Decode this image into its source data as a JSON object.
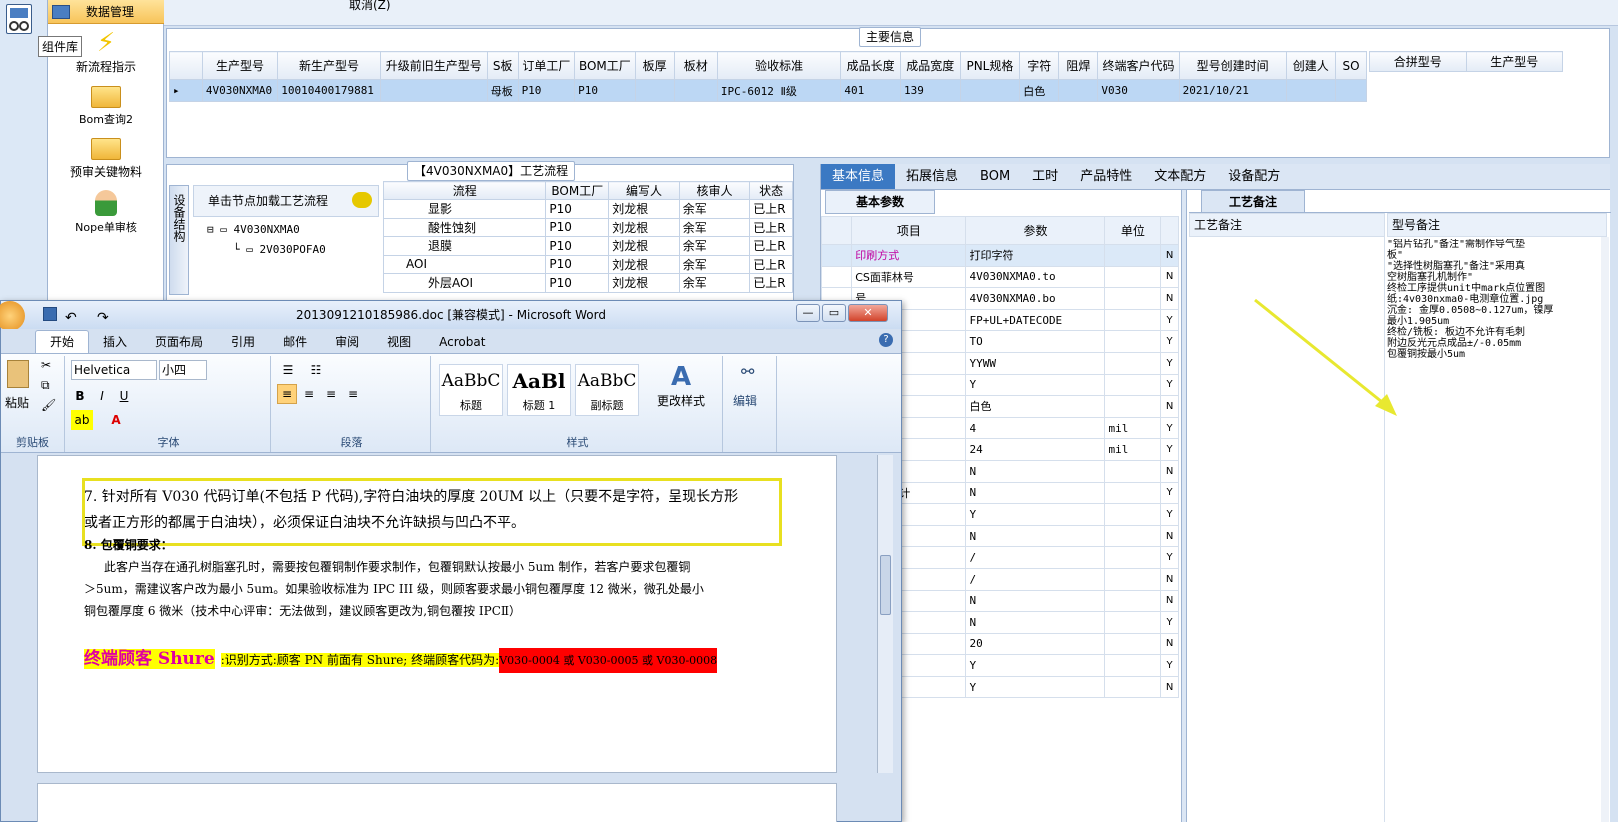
{
  "launcher": {
    "title": "数据管理",
    "tooltip": "组件库",
    "items": [
      "新流程指示",
      "Bom查询2",
      "预审关键物料",
      "Nope单审核"
    ]
  },
  "topstrip": {
    "cancel": "取消(Z)"
  },
  "main_info": {
    "title": "主要信息",
    "columns": [
      "生产型号",
      "新生产型号",
      "升级前旧生产型号",
      "S板",
      "订单工厂",
      "BOM工厂",
      "板厚",
      "板材",
      "验收标准",
      "成品长度",
      "成品宽度",
      "PNL规格",
      "字符",
      "阻焊",
      "终端客户代码",
      "型号创建时间",
      "创建人",
      "SO"
    ],
    "row": [
      "4V030NXMA0",
      "10010400179881",
      "",
      "母板",
      "P10",
      "P10",
      "",
      "",
      "IPC-6012 Ⅱ级",
      "401",
      "139",
      "",
      "白色",
      "",
      "V030",
      "2021/10/21",
      "",
      ""
    ],
    "side_columns": [
      "合拼型号",
      "生产型号"
    ]
  },
  "process": {
    "title": "【4V030NXMA0】工艺流程",
    "side_label": "设备结构",
    "hint": "单击节点加载工艺流程",
    "tree": [
      "4V030NXMA0",
      "2V030POFA0"
    ],
    "columns": [
      "流程",
      "BOM工厂",
      "编写人",
      "核审人",
      "状态"
    ],
    "rows": [
      [
        "显影",
        "P10",
        "刘龙根",
        "余军",
        "已上R"
      ],
      [
        "酸性蚀刻",
        "P10",
        "刘龙根",
        "余军",
        "已上R"
      ],
      [
        "退膜",
        "P10",
        "刘龙根",
        "余军",
        "已上R"
      ],
      [
        "AOI",
        "P10",
        "刘龙根",
        "余军",
        "已上R"
      ],
      [
        "外层AOI",
        "P10",
        "刘龙根",
        "余军",
        "已上R"
      ]
    ]
  },
  "right": {
    "tabs": [
      "基本信息",
      "拓展信息",
      "BOM",
      "工时",
      "产品特性",
      "文本配方",
      "设备配方"
    ],
    "subtab": "基本参数",
    "columns": [
      "项目",
      "参数",
      "单位"
    ],
    "rows": [
      [
        "印刷方式",
        "打印字符",
        "",
        "N"
      ],
      [
        "CS面菲林号",
        "4V030NXMA0.to",
        "",
        "N"
      ],
      [
        "号",
        "4V030NXMA0.bo",
        "",
        "N"
      ],
      [
        "",
        "FP+UL+DATECODE",
        "",
        "Y"
      ],
      [
        "位置",
        "TO",
        "",
        "Y"
      ],
      [
        "",
        "YYWW",
        "",
        "Y"
      ],
      [
        "记",
        "Y",
        "",
        "Y"
      ],
      [
        "",
        "白色",
        "",
        "N"
      ],
      [
        "线宽",
        "4",
        "mil",
        "Y"
      ],
      [
        "高度",
        "24",
        "mil",
        "Y"
      ],
      [
        "为阴字",
        "N",
        "",
        "N"
      ],
      [
        "面处理设计",
        "N",
        "",
        "Y"
      ],
      [
        "替周期",
        "Y",
        "",
        "Y"
      ],
      [
        "生产型号",
        "N",
        "",
        "N"
      ],
      [
        "置图纸",
        "/",
        "",
        "Y"
      ],
      [
        "置图纸",
        "/",
        "",
        "N"
      ],
      [
        "维码",
        "N",
        "",
        "N"
      ],
      [
        "字符",
        "N",
        "",
        "Y"
      ],
      [
        "厚度",
        "20",
        "",
        "N"
      ],
      [
        "整度要求",
        "Y",
        "",
        "Y"
      ],
      [
        "",
        "Y",
        "",
        "N"
      ]
    ],
    "remarks_tab": "工艺备注",
    "remarks_col": "工艺备注",
    "model_col": "型号备注",
    "model_notes": [
      "\"铝片钻孔\"备注\"需制作导气垫",
      "板\"",
      "\"选择性树脂塞孔\"备注\"采用真",
      "空树脂塞孔机制作\"",
      "终检工序提供unit中mark点位置图",
      "纸:4v030nxma0-电测章位置.jpg",
      "沉金: 金厚0.0508~0.127um，镍厚",
      "最小1.905um",
      "终检/铣板: 板边不允许有毛刺",
      "附边反光元点成品±/-0.05mm",
      "包覆铜按最小5um"
    ]
  },
  "word": {
    "title": "2013091210185986.doc [兼容模式] - Microsoft Word",
    "tabs": [
      "开始",
      "插入",
      "页面布局",
      "引用",
      "邮件",
      "审阅",
      "视图",
      "Acrobat"
    ],
    "font": "Helvetica",
    "size": "小四",
    "paste": "粘贴",
    "groups": [
      "剪贴板",
      "字体",
      "段落",
      "样式"
    ],
    "styles": [
      [
        "AaBbC",
        "标题"
      ],
      [
        "AaBl",
        "标题 1"
      ],
      [
        "AaBbC",
        "副标题"
      ]
    ],
    "change_style": "更改样式",
    "edit": "编辑",
    "doc": {
      "p1": "7. 针对所有 V030 代码订单(不包括 P 代码),字符白油块的厚度 20UM 以上（只要不是字符，呈现长方形",
      "p2": "或者正方形的都属于白油块），必须保证白油块不允许缺损与凹凸不平。",
      "p3": "8. 包覆铜要求：",
      "p4": "此客户当存在通孔树脂塞孔时，需要按包覆铜制作要求制作，包覆铜默认按最小 5um 制作，若客户要求包覆铜",
      "p5": "＞5um，需建议客户改为最小 5um。如果验收标准为 IPC III 级，则顾客要求最小铜包覆厚度 12 微米，微孔处最小",
      "p6": "铜包覆厚度 6 微米（技术中心评审：无法做到，建议顾客更改为,铜包覆按 IPCⅡ）",
      "hl1": "终端顾客 Shure",
      "hl2": ":识别方式:顾客 PN 前面有 Shure; 终端顾客代码为:",
      "hl3": "V030-0004 或 V030-0005 或 V030-0008"
    }
  },
  "colors": {
    "accent": "#3b79c3",
    "highlight_box": "#e8e020",
    "arrow": "#e8e830",
    "red": "#ff0000",
    "yellow": "#ffff00"
  }
}
